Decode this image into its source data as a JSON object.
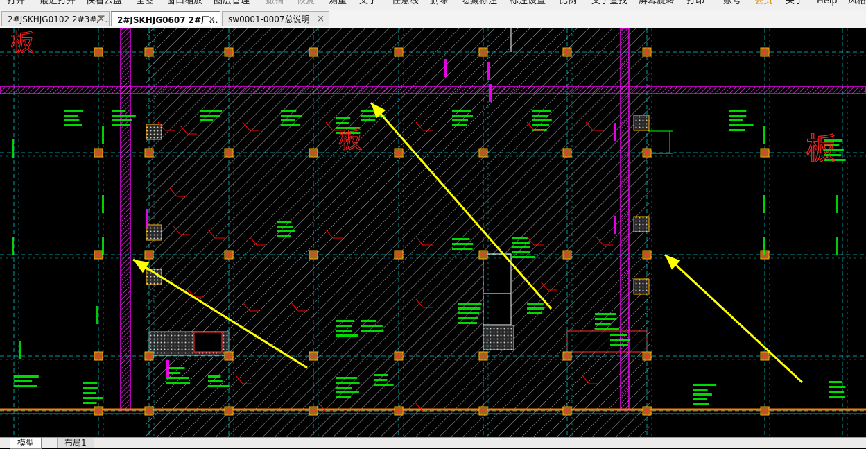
{
  "menu": [
    {
      "label": "打开",
      "state": "normal"
    },
    {
      "label": "最近打开",
      "state": "normal"
    },
    {
      "label": "快看云盘",
      "state": "normal"
    },
    {
      "label": "全图",
      "state": "normal"
    },
    {
      "label": "窗口缩放",
      "state": "normal"
    },
    {
      "label": "图层管理",
      "state": "normal"
    },
    {
      "label": "撤销",
      "state": "disabled"
    },
    {
      "label": "恢复",
      "state": "disabled"
    },
    {
      "label": "测量",
      "state": "normal"
    },
    {
      "label": "文字",
      "state": "normal"
    },
    {
      "label": "任意线",
      "state": "normal"
    },
    {
      "label": "删除",
      "state": "normal"
    },
    {
      "label": "隐藏标注",
      "state": "normal"
    },
    {
      "label": "标注设置",
      "state": "normal"
    },
    {
      "label": "比例",
      "state": "normal"
    },
    {
      "label": "文字查找",
      "state": "normal"
    },
    {
      "label": "屏幕旋转",
      "state": "normal"
    },
    {
      "label": "打印",
      "state": "normal"
    },
    {
      "label": "账号",
      "state": "normal"
    },
    {
      "label": "会员",
      "state": "vip"
    },
    {
      "label": "关于",
      "state": "normal"
    },
    {
      "label": "Help",
      "state": "normal"
    },
    {
      "label": "风格",
      "state": "normal"
    }
  ],
  "document_tabs": [
    {
      "label": "2#JSKHJG0102 2#3#厂…",
      "close": "×",
      "active": false
    },
    {
      "label": "2#JSKHJG0607   2#厂…",
      "close": "×",
      "active": true
    },
    {
      "label": "sw0001-0007总说明",
      "close": "×",
      "active": false
    }
  ],
  "layout_tabs": [
    {
      "label": "模型",
      "active": true
    },
    {
      "label": "布局1",
      "active": false
    }
  ],
  "drawing": {
    "colors": {
      "background": "#000000",
      "grid": "#00c8c8",
      "rebar": "#00ff00",
      "beam": "#ff00ff",
      "mark": "#ff0000",
      "arrow": "#ffff00",
      "hatch": "#bdbdbd",
      "column": "#ffb000"
    },
    "annotations": [
      {
        "text": "板"
      },
      {
        "text": "板"
      },
      {
        "text": "板"
      }
    ]
  }
}
